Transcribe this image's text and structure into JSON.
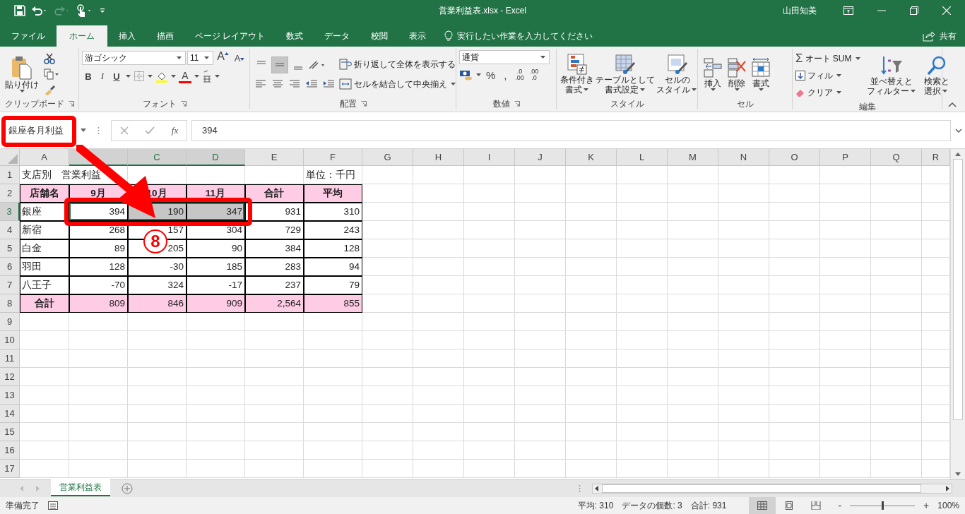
{
  "window": {
    "title": "営業利益表.xlsx  -  Excel",
    "user": "山田知美"
  },
  "tabs": [
    {
      "label": "ファイル",
      "selected": false
    },
    {
      "label": "ホーム",
      "selected": true
    },
    {
      "label": "挿入",
      "selected": false
    },
    {
      "label": "描画",
      "selected": false
    },
    {
      "label": "ページ レイアウト",
      "selected": false
    },
    {
      "label": "数式",
      "selected": false
    },
    {
      "label": "データ",
      "selected": false
    },
    {
      "label": "校閲",
      "selected": false
    },
    {
      "label": "表示",
      "selected": false
    }
  ],
  "tell_me": {
    "placeholder": "実行したい作業を入力してください"
  },
  "share": {
    "label": "共有"
  },
  "ribbon": {
    "clipboard": {
      "label": "クリップボード",
      "paste": "貼り付け"
    },
    "font": {
      "label": "フォント",
      "font_name": "游ゴシック",
      "font_size": "11",
      "grow": "A",
      "shrink": "A",
      "bold": "B",
      "italic": "I",
      "underline": "U",
      "font_color": "A"
    },
    "alignment": {
      "label": "配置",
      "vertical": [
        {
          "selected": false
        },
        {
          "selected": true
        },
        {
          "selected": false
        }
      ],
      "wrap": "折り返して全体を表示する",
      "merge": "セルを結合して中央揃え"
    },
    "number": {
      "label": "数値",
      "format": "通貨",
      "percent": "%",
      "comma": ",",
      "decimals": [
        {
          "top": ".0",
          "bottom": ".00"
        },
        {
          "top": ".00",
          "bottom": ".0"
        }
      ]
    },
    "styles": {
      "label": "スタイル",
      "buttons": [
        {
          "kind": "conditional",
          "lines": [
            "条件付き",
            "書式"
          ]
        },
        {
          "kind": "table",
          "lines": [
            "テーブルとして",
            "書式設定"
          ]
        },
        {
          "kind": "cellstyle",
          "lines": [
            "セルの",
            "スタイル"
          ]
        }
      ]
    },
    "cells": {
      "label": "セル",
      "buttons": [
        {
          "kind": "insert",
          "label": "挿入"
        },
        {
          "kind": "delete",
          "label": "削除"
        },
        {
          "kind": "format",
          "label": "書式"
        }
      ]
    },
    "editing": {
      "label": "編集",
      "sigma": "Σ",
      "autosum": "オート SUM",
      "fill": "フィル",
      "clear": "クリア",
      "sort": [
        "並べ替えと",
        "フィルター"
      ],
      "find": [
        "検索と",
        "選択"
      ]
    }
  },
  "name_box": {
    "value": "銀座各月利益"
  },
  "formula_bar": {
    "fx": "fx",
    "value": "394"
  },
  "sheet": {
    "columns": [
      {
        "label": "A",
        "selected": false
      },
      {
        "selected": true
      },
      {
        "label": "C",
        "selected": true
      },
      {
        "label": "D",
        "selected": true
      },
      {
        "label": "E",
        "selected": false
      },
      {
        "label": "F",
        "selected": false
      },
      {
        "label": "G",
        "selected": false
      },
      {
        "label": "H",
        "selected": false
      },
      {
        "label": "I",
        "selected": false
      },
      {
        "label": "J",
        "selected": false
      },
      {
        "label": "K",
        "selected": false
      },
      {
        "label": "L",
        "selected": false
      },
      {
        "label": "M",
        "selected": false
      },
      {
        "label": "N",
        "selected": false
      },
      {
        "label": "O",
        "selected": false
      },
      {
        "label": "P",
        "selected": false
      },
      {
        "label": "Q",
        "selected": false
      },
      {
        "label": "R",
        "selected": false
      }
    ],
    "rows": [
      {
        "number": "1",
        "kind": "title",
        "selected": false,
        "cells": [
          {
            "text": "支店別　営業利益",
            "selected": false
          },
          {
            "selected": false
          },
          {
            "selected": false
          },
          {
            "selected": false
          },
          {
            "selected": false
          },
          {
            "text": "単位：千円",
            "selected": false
          }
        ]
      },
      {
        "number": "2",
        "kind": "header",
        "selected": false,
        "cells": [
          {
            "text": "店舗名",
            "selected": false
          },
          {
            "text": "9月",
            "selected": false
          },
          {
            "text": "10月",
            "selected": false
          },
          {
            "text": "11月",
            "selected": false
          },
          {
            "text": "合計",
            "selected": false
          },
          {
            "text": "平均",
            "selected": false
          }
        ]
      },
      {
        "number": "3",
        "kind": "data",
        "selected": true,
        "cells": [
          {
            "text": "銀座",
            "selected": false
          },
          {
            "text": "394",
            "selected": true
          },
          {
            "text": "190",
            "selected": true
          },
          {
            "text": "347",
            "selected": true
          },
          {
            "text": "931",
            "selected": false
          },
          {
            "text": "310",
            "selected": false
          }
        ]
      },
      {
        "number": "4",
        "kind": "data",
        "selected": false,
        "cells": [
          {
            "text": "新宿",
            "selected": false
          },
          {
            "text": "268",
            "selected": false
          },
          {
            "text": "157",
            "selected": false
          },
          {
            "text": "304",
            "selected": false
          },
          {
            "text": "729",
            "selected": false
          },
          {
            "text": "243",
            "selected": false
          }
        ]
      },
      {
        "number": "5",
        "kind": "data",
        "selected": false,
        "cells": [
          {
            "text": "白金",
            "selected": false
          },
          {
            "text": "89",
            "selected": false
          },
          {
            "text": "205",
            "selected": false
          },
          {
            "text": "90",
            "selected": false
          },
          {
            "text": "384",
            "selected": false
          },
          {
            "text": "128",
            "selected": false
          }
        ]
      },
      {
        "number": "6",
        "kind": "data",
        "selected": false,
        "cells": [
          {
            "text": "羽田",
            "selected": false
          },
          {
            "text": "128",
            "selected": false
          },
          {
            "text": "-30",
            "selected": false
          },
          {
            "text": "185",
            "selected": false
          },
          {
            "text": "283",
            "selected": false
          },
          {
            "text": "94",
            "selected": false
          }
        ]
      },
      {
        "number": "7",
        "kind": "data",
        "selected": false,
        "cells": [
          {
            "text": "八王子",
            "selected": false
          },
          {
            "text": "-70",
            "selected": false
          },
          {
            "text": "324",
            "selected": false
          },
          {
            "text": "-17",
            "selected": false
          },
          {
            "text": "237",
            "selected": false
          },
          {
            "text": "79",
            "selected": false
          }
        ]
      },
      {
        "number": "8",
        "kind": "total",
        "selected": false,
        "cells": [
          {
            "text": "合計",
            "selected": false
          },
          {
            "text": "809",
            "selected": false
          },
          {
            "text": "846",
            "selected": false
          },
          {
            "text": "909",
            "selected": false
          },
          {
            "text": "2,564",
            "selected": false
          },
          {
            "text": "855",
            "selected": false
          }
        ]
      },
      {
        "number": "9",
        "kind": "empty",
        "selected": false
      },
      {
        "number": "10",
        "kind": "empty",
        "selected": false
      },
      {
        "number": "11",
        "kind": "empty",
        "selected": false
      },
      {
        "number": "12",
        "kind": "empty",
        "selected": false
      },
      {
        "number": "13",
        "kind": "empty",
        "selected": false
      },
      {
        "number": "14",
        "kind": "empty",
        "selected": false
      },
      {
        "number": "15",
        "kind": "empty",
        "selected": false
      },
      {
        "number": "16",
        "kind": "empty",
        "selected": false
      },
      {
        "number": "17",
        "kind": "empty",
        "selected": false
      }
    ]
  },
  "sheet_tabs": [
    {
      "label": "営業利益表",
      "selected": true
    }
  ],
  "status_bar": {
    "ready": "準備完了",
    "average": "平均: 310",
    "count": "データの個数: 3",
    "sum": "合計: 931",
    "views": [
      {
        "kind": "normal",
        "selected": true
      },
      {
        "kind": "layout",
        "selected": false
      },
      {
        "kind": "pagebreak",
        "selected": false
      }
    ],
    "zoom": {
      "minus": "-",
      "plus": "+",
      "level": 0.5,
      "label": "100%"
    }
  },
  "annotation": {
    "step": "8"
  }
}
